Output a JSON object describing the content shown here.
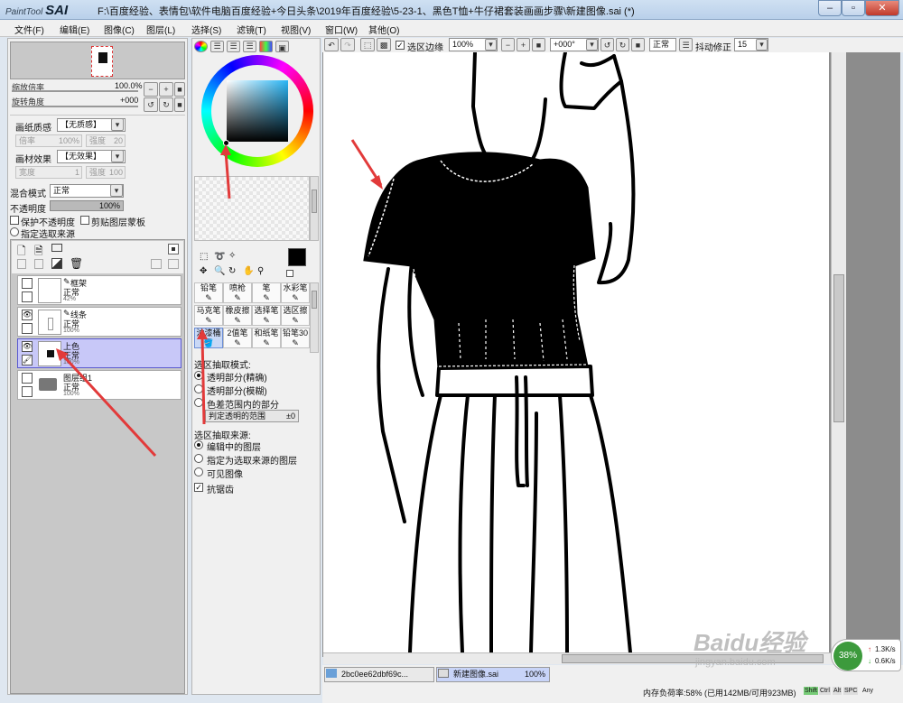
{
  "window": {
    "logo_small": "PaintTool",
    "logo_big": "SAI",
    "title": "F:\\百度经验、表情包\\软件电脑百度经验+今日头条\\2019年百度经验\\5-23-1、黑色T恤+牛仔裙套装画画步骤\\新建图像.sai (*)"
  },
  "menu": [
    "文件(F)",
    "编辑(E)",
    "图像(C)",
    "图层(L)",
    "选择(S)",
    "滤镜(T)",
    "视图(V)",
    "窗口(W)",
    "其他(O)"
  ],
  "navigator": {
    "zoom_label": "缩放倍率",
    "zoom_value": "100.0%",
    "rotate_label": "旋转角度",
    "rotate_value": "+000"
  },
  "paper": {
    "texture_label": "画纸质感",
    "texture_value": "【无质感】",
    "scale_label": "倍率",
    "scale_value": "100%",
    "strength_label": "强度",
    "strength_value": "20",
    "effect_label": "画材效果",
    "effect_value": "【无效果】",
    "width_label": "宽度",
    "width_value": "1",
    "effect_strength_label": "强度",
    "effect_strength_value": "100"
  },
  "blend": {
    "mode_label": "混合模式",
    "mode_value": "正常",
    "opacity_label": "不透明度",
    "opacity_value": "100%",
    "protect_label": "保护不透明度",
    "clip_label": "剪贴图层蒙板",
    "selection_source_label": "指定选取来源"
  },
  "layers": [
    {
      "name": "框架",
      "mode": "正常",
      "opacity": "42%"
    },
    {
      "name": "线条",
      "mode": "正常",
      "opacity": "100%"
    },
    {
      "name": "上色",
      "mode": "正常",
      "opacity": "100%"
    },
    {
      "name": "图层组1",
      "mode": "正常",
      "opacity": "100%"
    }
  ],
  "tools": {
    "brushes": [
      "铅笔",
      "喷枪",
      "笔",
      "水彩笔",
      "马克笔",
      "橡皮擦",
      "选择笔",
      "选区擦",
      "油漆桶",
      "2值笔",
      "和纸笔",
      "铅笔30"
    ]
  },
  "fill_options": {
    "mode_title": "选区抽取模式:",
    "opt1": "透明部分(精确)",
    "opt2": "透明部分(模糊)",
    "opt3": "色差范围内的部分",
    "range_label": "判定透明的范围",
    "range_value": "±0",
    "source_title": "选区抽取来源:",
    "src1": "编辑中的图层",
    "src2": "指定为选取来源的图层",
    "src3": "可见图像",
    "antialias": "抗锯齿"
  },
  "toolbar": {
    "selection_edge": "选区边缘",
    "zoom": "100%",
    "angle": "+000°",
    "mode": "正常",
    "stabilizer_label": "抖动修正",
    "stabilizer_value": "15"
  },
  "tabs": [
    {
      "name": "2bc0ee62dbf69c...",
      "zoom": "100%"
    },
    {
      "name": "新建图像.sai",
      "zoom": "100%"
    }
  ],
  "status": {
    "memory": "内存负荷率:58% (已用142MB/可用923MB)",
    "keys": [
      "Shift",
      "Ctrl",
      "Alt",
      "SPC",
      "Any"
    ],
    "net_up": "1.3K/s",
    "net_down": "0.6K/s",
    "net_pct": "38%"
  },
  "watermark": {
    "brand": "Baidu经验",
    "url": "jingyan.baidu.com"
  }
}
